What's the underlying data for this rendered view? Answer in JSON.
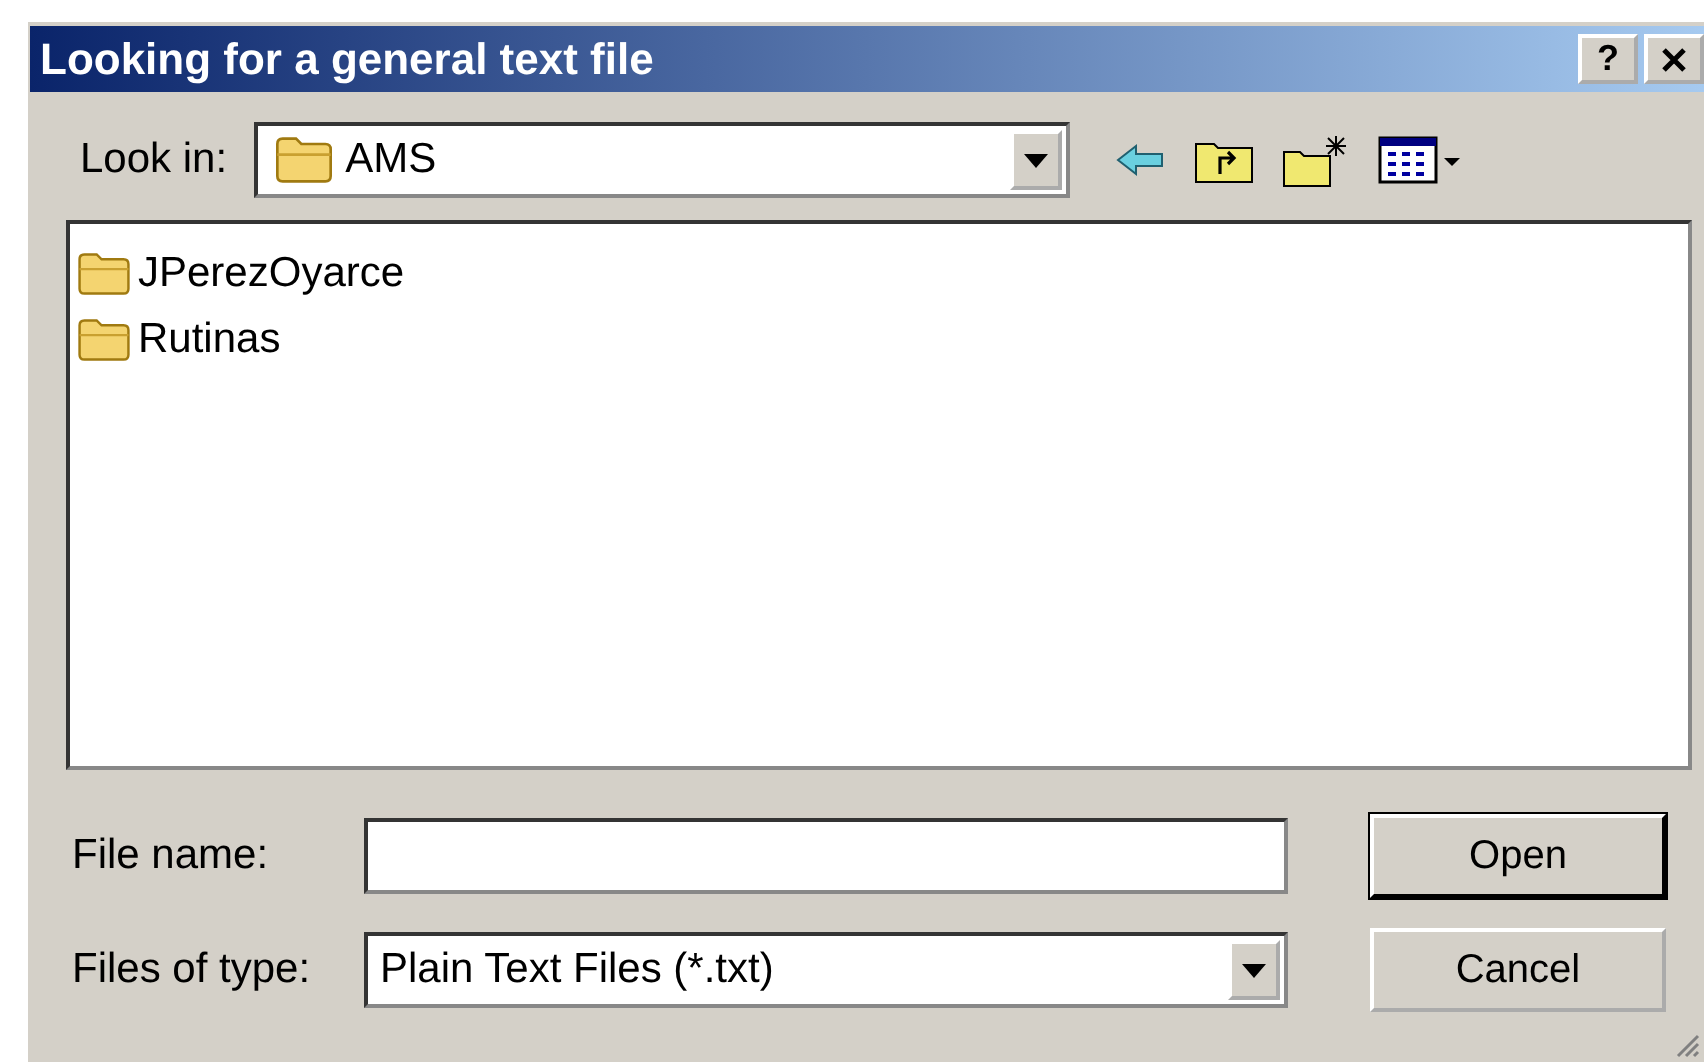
{
  "window": {
    "title": "Looking for a general text file",
    "help_button": "?"
  },
  "look_in": {
    "label": "Look in:",
    "value": "AMS"
  },
  "files": [
    {
      "name": "JPerezOyarce",
      "kind": "folder"
    },
    {
      "name": "Rutinas",
      "kind": "folder"
    }
  ],
  "file_name": {
    "label": "File name:"
  },
  "file_type": {
    "label": "Files of type:",
    "value": "Plain Text Files (*.txt)"
  },
  "buttons": [
    {
      "label": "Open",
      "default": true
    },
    {
      "label": "Cancel",
      "default": false
    }
  ]
}
